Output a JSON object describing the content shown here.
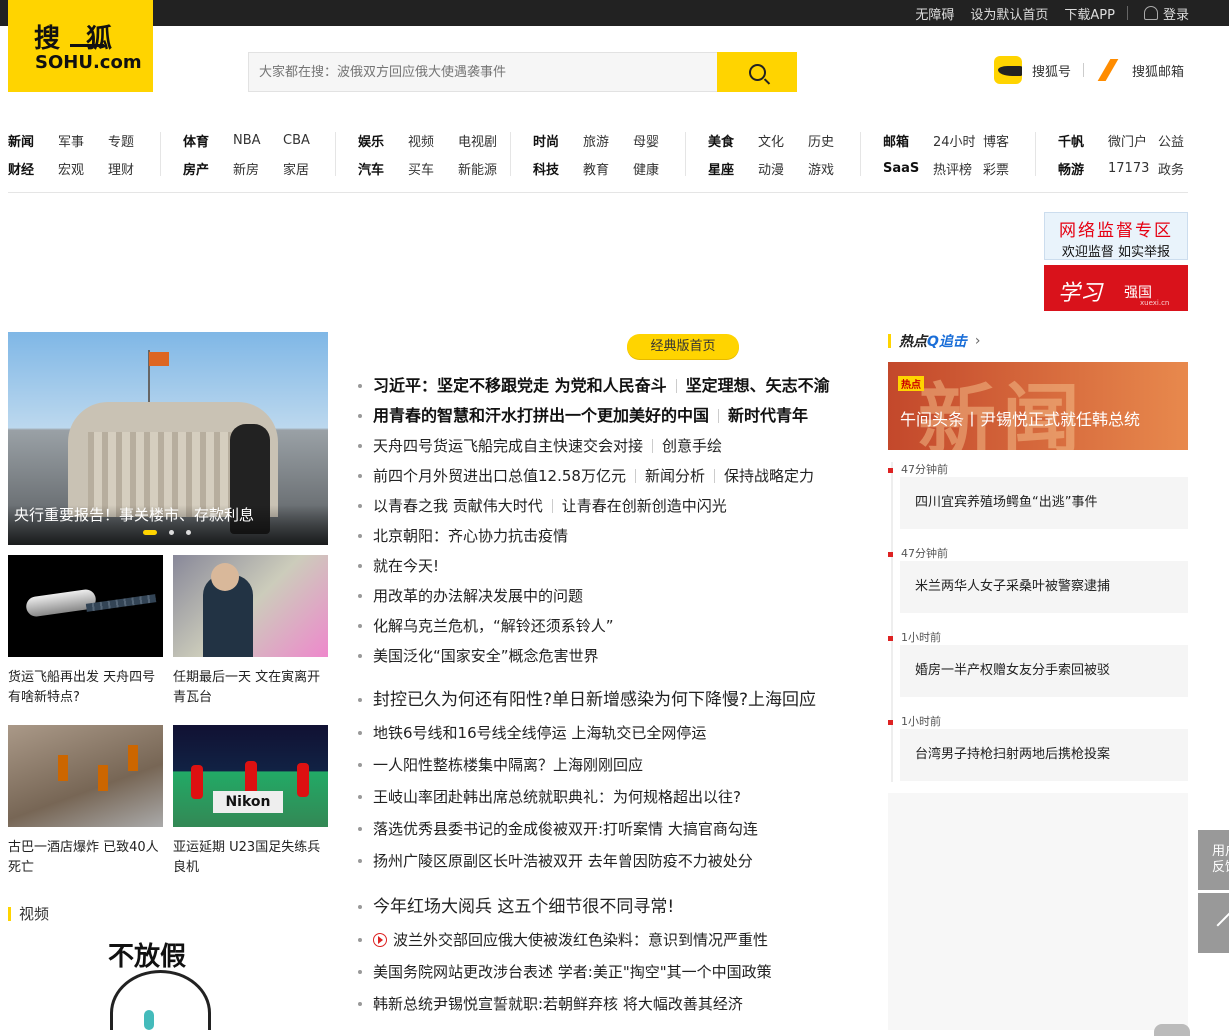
{
  "topbar": {
    "links": [
      "无障碍",
      "设为默认首页",
      "下载APP"
    ],
    "login": "登录"
  },
  "logo": {
    "cn": "搜狐",
    "en": "SOHU.com"
  },
  "search": {
    "placeholder": "大家都在搜：波俄双方回应俄大使遇袭事件"
  },
  "header_links": {
    "sohuhao": "搜狐号",
    "mail": "搜狐邮箱"
  },
  "nav": [
    {
      "rows": [
        [
          "新闻",
          "军事",
          "专题"
        ],
        [
          "财经",
          "宏观",
          "理财"
        ]
      ]
    },
    {
      "rows": [
        [
          "体育",
          "NBA",
          "CBA"
        ],
        [
          "房产",
          "新房",
          "家居"
        ]
      ]
    },
    {
      "rows": [
        [
          "娱乐",
          "视频",
          "电视剧"
        ],
        [
          "汽车",
          "买车",
          "新能源"
        ]
      ]
    },
    {
      "rows": [
        [
          "时尚",
          "旅游",
          "母婴"
        ],
        [
          "科技",
          "教育",
          "健康"
        ]
      ]
    },
    {
      "rows": [
        [
          "美食",
          "文化",
          "历史"
        ],
        [
          "星座",
          "动漫",
          "游戏"
        ]
      ]
    },
    {
      "rows": [
        [
          "邮箱",
          "24小时",
          "博客"
        ],
        [
          "SaaS",
          "热评榜",
          "彩票"
        ]
      ]
    },
    {
      "rows": [
        [
          "千帆",
          "微门户",
          "公益"
        ],
        [
          "畅游",
          "17173",
          "政务"
        ]
      ]
    }
  ],
  "ads": {
    "report_title": "网络监督专区",
    "report_sub": "欢迎监督 如实举报",
    "xuexi_script": "学习",
    "xuexi_main": "强国",
    "xuexi_url": "xuexi.cn"
  },
  "focus": {
    "title": "央行重要报告！事关楼市、存款利息"
  },
  "pics": [
    {
      "caption": "货运飞船再出发 天舟四号有啥新特点?"
    },
    {
      "caption": "任期最后一天 文在寅离开青瓦台"
    },
    {
      "caption": "古巴一酒店爆炸 已致40人死亡"
    },
    {
      "caption": "亚运延期 U23国足失练兵良机"
    }
  ],
  "pic4_banner": "Nikon",
  "video": {
    "label": "视频",
    "meme_text": "不放假"
  },
  "classic_btn": "经典版首页",
  "news_group1": [
    {
      "a": "习近平：坚定不移跟党走 为党和人民奋斗",
      "b": "坚定理想、矢志不渝",
      "bold": true
    },
    {
      "a": "用青春的智慧和汗水打拼出一个更加美好的中国",
      "b": "新时代青年",
      "bold": true
    },
    {
      "a": "天舟四号货运飞船完成自主快速交会对接",
      "b": "创意手绘"
    },
    {
      "a": "前四个月外贸进出口总值12.58万亿元",
      "b": "新闻分析",
      "c": "保持战略定力"
    },
    {
      "a": "以青春之我 贡献伟大时代",
      "b": "让青春在创新创造中闪光"
    },
    {
      "a": "北京朝阳：齐心协力抗击疫情"
    },
    {
      "a": "就在今天!"
    },
    {
      "a": "用改革的办法解决发展中的问题"
    },
    {
      "a": "化解乌克兰危机，“解铃还须系铃人”"
    },
    {
      "a": "美国泛化“国家安全”概念危害世界"
    }
  ],
  "news_group2": {
    "headline": "封控已久为何还有阳性?单日新增感染为何下降慢?上海回应",
    "items": [
      "地铁6号线和16号线全线停运 上海轨交已全网停运",
      "一人阳性整栋楼集中隔离？上海刚刚回应",
      "王岐山率团赴韩出席总统就职典礼：为何规格超出以往?",
      "落选优秀县委书记的金成俊被双开:打听案情 大搞官商勾连",
      "扬州广陵区原副区长叶浩被双开 去年曾因防疫不力被处分"
    ]
  },
  "news_group3": {
    "headline": "今年红场大阅兵 这五个细节很不同寻常!",
    "items": [
      "波兰外交部回应俄大使被泼红色染料：意识到情况严重性",
      "美国务院网站更改涉台表述 学者:美正\"掏空\"其一个中国政策",
      "韩新总统尹锡悦宣誓就职:若朝鲜弃核 将大幅改善其经济"
    ]
  },
  "hot": {
    "head_part1": "热点",
    "head_part2": "Q追击",
    "arrow": "›",
    "img_badge": "热点",
    "img_bg_text": "新闻",
    "img_title": "午间头条丨尹锡悦正式就任韩总统",
    "items": [
      {
        "time": "47分钟前",
        "title": "四川宜宾养殖场鳄鱼“出逃”事件"
      },
      {
        "time": "47分钟前",
        "title": "米兰两华人女子采桑叶被警察逮捕"
      },
      {
        "time": "1小时前",
        "title": "婚房一半产权赠女友分手索回被驳"
      },
      {
        "time": "1小时前",
        "title": "台湾男子持枪扫射两地后携枪投案"
      }
    ]
  },
  "side": {
    "feedback": "用户反馈"
  }
}
